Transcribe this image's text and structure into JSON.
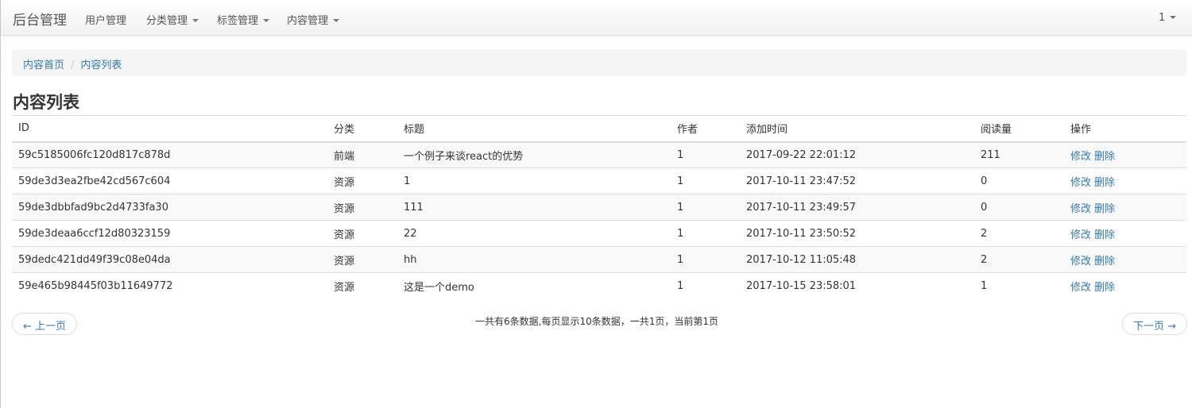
{
  "navbar": {
    "brand": "后台管理",
    "items": [
      {
        "label": "用户管理"
      },
      {
        "label": "分类管理"
      },
      {
        "label": "标签管理"
      },
      {
        "label": "内容管理"
      }
    ],
    "user": "1"
  },
  "breadcrumb": {
    "home": "内容首页",
    "separator": "/",
    "current": "内容列表"
  },
  "page_title": "内容列表",
  "table": {
    "headers": [
      "ID",
      "分类",
      "标题",
      "作者",
      "添加时间",
      "阅读量",
      "操作"
    ],
    "rows": [
      {
        "id": "59c5185006fc120d817c878d",
        "category": "前端",
        "title": "一个例子来谈react的优势",
        "author": "1",
        "time": "2017-09-22 22:01:12",
        "views": "211",
        "edit": "修改",
        "delete": "删除"
      },
      {
        "id": "59de3d3ea2fbe42cd567c604",
        "category": "资源",
        "title": "1",
        "author": "1",
        "time": "2017-10-11 23:47:52",
        "views": "0",
        "edit": "修改",
        "delete": "删除"
      },
      {
        "id": "59de3dbbfad9bc2d4733fa30",
        "category": "资源",
        "title": "111",
        "author": "1",
        "time": "2017-10-11 23:49:57",
        "views": "0",
        "edit": "修改",
        "delete": "删除"
      },
      {
        "id": "59de3deaa6ccf12d80323159",
        "category": "资源",
        "title": "22",
        "author": "1",
        "time": "2017-10-11 23:50:52",
        "views": "2",
        "edit": "修改",
        "delete": "删除"
      },
      {
        "id": "59dedc421dd49f39c08e04da",
        "category": "资源",
        "title": "hh",
        "author": "1",
        "time": "2017-10-12 11:05:48",
        "views": "2",
        "edit": "修改",
        "delete": "删除"
      },
      {
        "id": "59e465b98445f03b11649772",
        "category": "资源",
        "title": "这是一个demo",
        "author": "1",
        "time": "2017-10-15 23:58:01",
        "views": "1",
        "edit": "修改",
        "delete": "删除"
      }
    ]
  },
  "pager": {
    "prev": "← 上一页",
    "info": "一共有6条数据,每页显示10条数据，一共1页，当前第1页",
    "next": "下一页 →"
  }
}
